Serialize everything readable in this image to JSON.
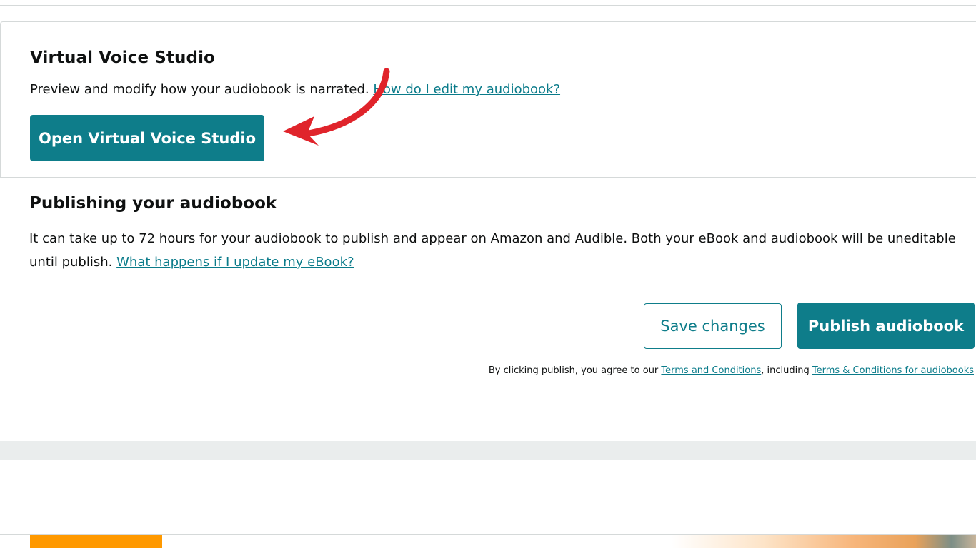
{
  "virtual_voice": {
    "title": "Virtual Voice Studio",
    "description": "Preview and modify how your audiobook is narrated.",
    "help_link": "How do I edit my audiobook?",
    "open_button": "Open Virtual Voice Studio"
  },
  "publishing": {
    "title": "Publishing your audiobook",
    "description": "It can take up to 72 hours for your audiobook to publish and appear on Amazon and Audible. Both your eBook and audiobook will be uneditable until publish.",
    "help_link": "What happens if I update my eBook?"
  },
  "actions": {
    "save_label": "Save changes",
    "publish_label": "Publish audiobook"
  },
  "agreement": {
    "prefix": "By clicking publish, you agree to our",
    "terms_link": "Terms and Conditions",
    "middle": ", including",
    "audiobook_terms_link": "Terms & Conditions for audiobooks"
  },
  "colors": {
    "accent": "#0e7d8a",
    "link": "#0a7b8a",
    "annotation_arrow": "#e0242b",
    "footer_tab": "#ff9900"
  }
}
